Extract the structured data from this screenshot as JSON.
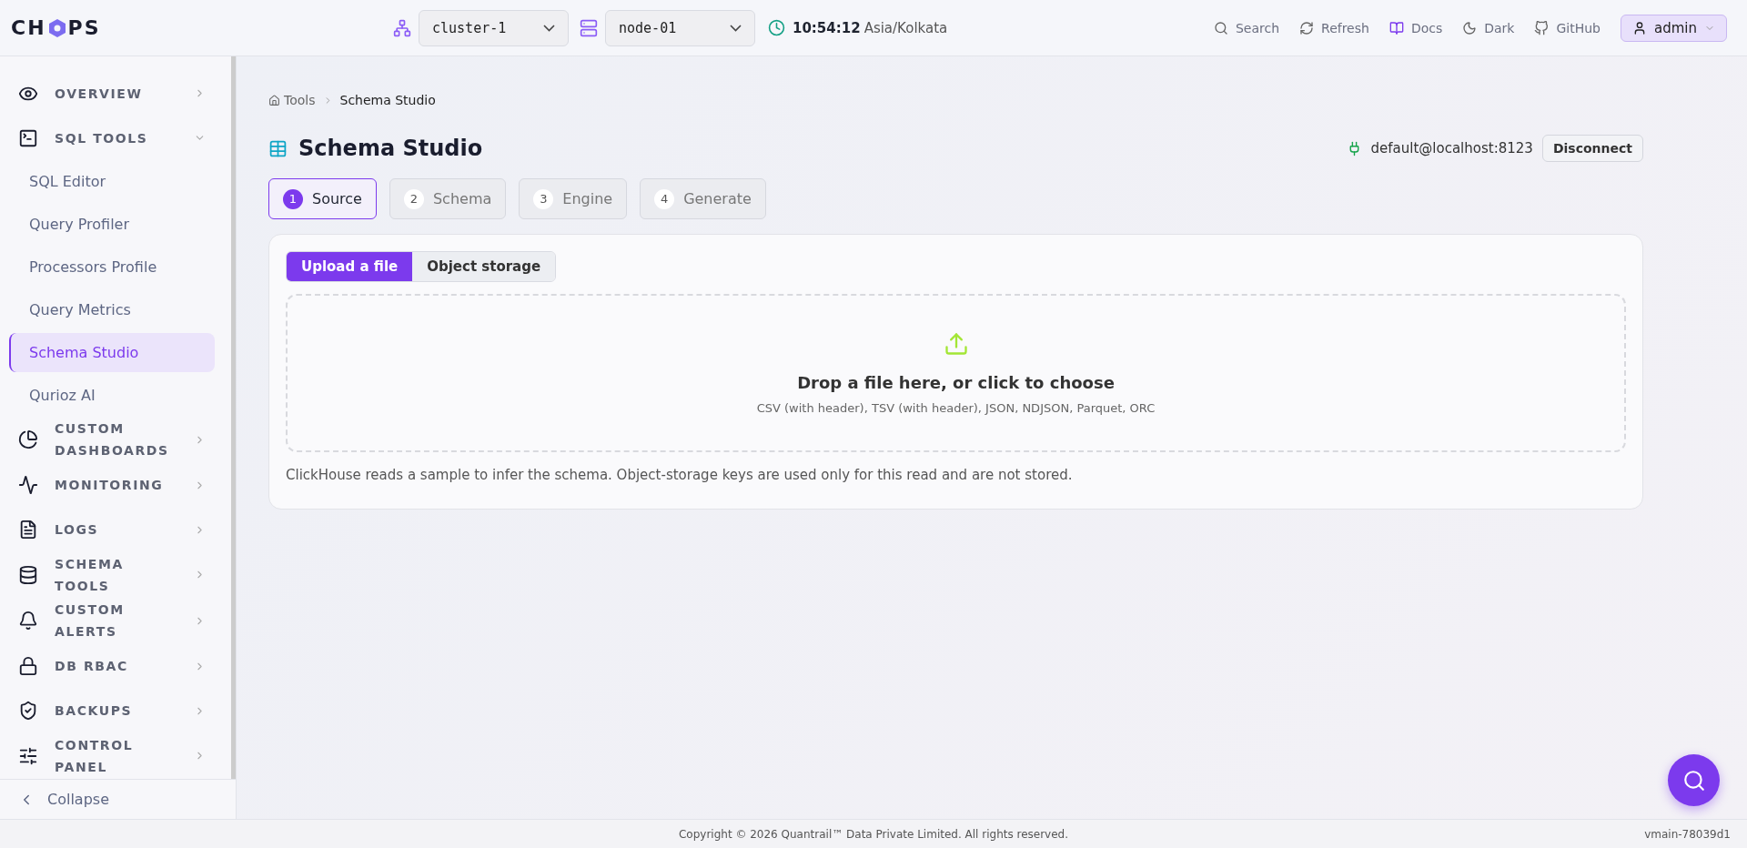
{
  "header": {
    "logo": {
      "left": "CH",
      "right": "PS"
    },
    "selectors": [
      {
        "kind": "cluster",
        "value": "cluster-1"
      },
      {
        "kind": "node",
        "value": "node-01"
      }
    ],
    "clock": {
      "time": "10:54:12",
      "zone": "Asia/Kolkata"
    },
    "actions": [
      {
        "kind": "search",
        "label": "Search"
      },
      {
        "kind": "refresh",
        "label": "Refresh"
      },
      {
        "kind": "docs",
        "label": "Docs"
      },
      {
        "kind": "theme",
        "label": "Dark"
      },
      {
        "kind": "github",
        "label": "GitHub"
      }
    ],
    "user": {
      "label": "admin"
    }
  },
  "sidebar": {
    "items": [
      {
        "kind": "overview",
        "label": "OVERVIEW",
        "expanded": false
      },
      {
        "kind": "sql",
        "label": "SQL TOOLS",
        "expanded": true,
        "children": [
          {
            "label": "SQL Editor",
            "selected": false
          },
          {
            "label": "Query Profiler",
            "selected": false
          },
          {
            "label": "Processors Profile",
            "selected": false
          },
          {
            "label": "Query Metrics",
            "selected": false
          },
          {
            "label": "Schema Studio",
            "selected": true
          },
          {
            "label": "Qurioz AI",
            "selected": false
          }
        ]
      },
      {
        "kind": "dashboards",
        "label": "CUSTOM DASHBOARDS",
        "expanded": false
      },
      {
        "kind": "monitoring",
        "label": "MONITORING",
        "expanded": false
      },
      {
        "kind": "logs",
        "label": "LOGS",
        "expanded": false
      },
      {
        "kind": "schema",
        "label": "SCHEMA TOOLS",
        "expanded": false
      },
      {
        "kind": "alerts",
        "label": "CUSTOM ALERTS",
        "expanded": false
      },
      {
        "kind": "rbac",
        "label": "DB RBAC",
        "expanded": false
      },
      {
        "kind": "backups",
        "label": "BACKUPS",
        "expanded": false
      },
      {
        "kind": "control",
        "label": "CONTROL PANEL",
        "expanded": false
      }
    ],
    "collapse": "Collapse"
  },
  "breadcrumb": [
    "Tools",
    "Schema Studio"
  ],
  "page": {
    "title": "Schema Studio",
    "connection": "default@localhost:8123",
    "disconnect": "Disconnect"
  },
  "steps": [
    {
      "number": "1",
      "label": "Source",
      "selected": true
    },
    {
      "number": "2",
      "label": "Schema",
      "selected": false
    },
    {
      "number": "3",
      "label": "Engine",
      "selected": false
    },
    {
      "number": "4",
      "label": "Generate",
      "selected": false
    }
  ],
  "source_tabs": [
    {
      "label": "Upload a file",
      "selected": true
    },
    {
      "label": "Object storage",
      "selected": false
    }
  ],
  "dropzone": {
    "title": "Drop a file here, or click to choose",
    "formats": "CSV (with header), TSV (with header), JSON, NDJSON, Parquet, ORC"
  },
  "note": "ClickHouse reads a sample to infer the schema. Object-storage keys are used only for this read and are not stored.",
  "footer": {
    "copyright": "Copyright © 2026 Quantrail™ Data Private Limited. All rights reserved.",
    "version": "vmain-78039d1"
  }
}
